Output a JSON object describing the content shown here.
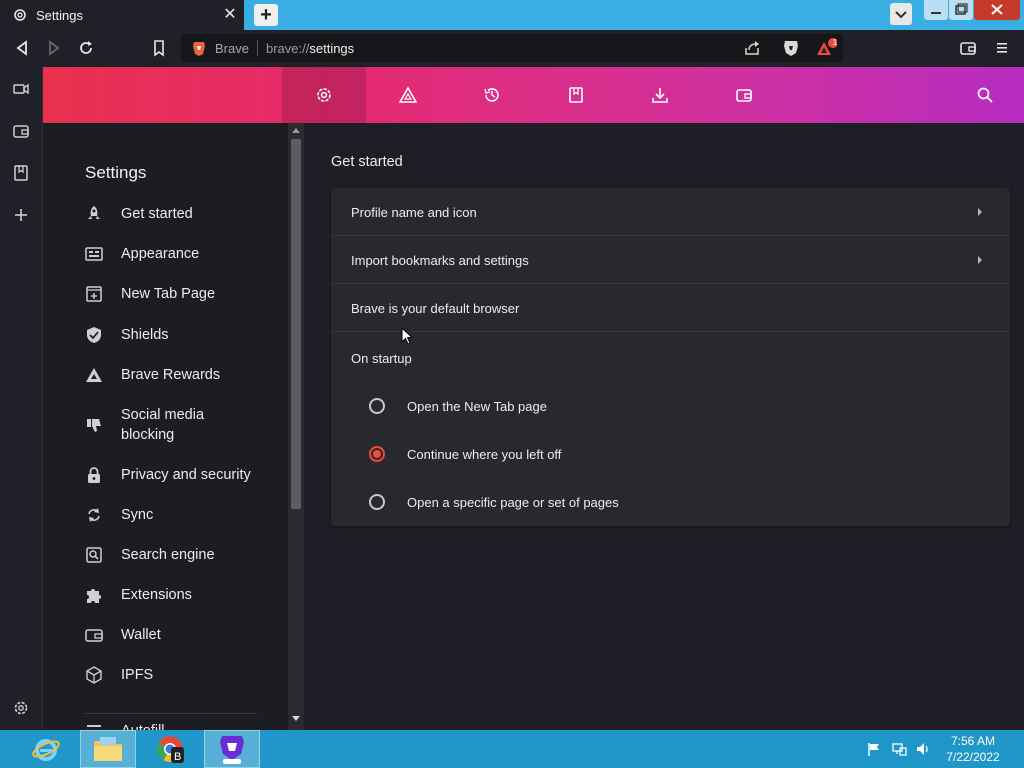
{
  "window": {
    "tab_title": "Settings",
    "tab_close": "✕",
    "new_tab": "+"
  },
  "toolbar": {
    "omnibox_brand": "Brave",
    "url_scheme": "brave://",
    "url_path": "settings",
    "rewards_badge": "1"
  },
  "sidebar_icons": [
    "video-call-icon",
    "wallet-icon",
    "bookmarks-icon",
    "add-icon",
    "settings-icon"
  ],
  "header": {
    "items": [
      "settings-gear-icon",
      "rewards-triangle-icon",
      "history-icon",
      "bookmarks-icon",
      "downloads-icon",
      "wallet-icon"
    ],
    "search_icon": "search-icon"
  },
  "nav": {
    "title": "Settings",
    "items": [
      {
        "label": "Get started",
        "icon": "rocket-icon"
      },
      {
        "label": "Appearance",
        "icon": "appearance-icon"
      },
      {
        "label": "New Tab Page",
        "icon": "new-tab-page-icon"
      },
      {
        "label": "Shields",
        "icon": "shield-icon"
      },
      {
        "label": "Brave Rewards",
        "icon": "rewards-triangle-icon"
      },
      {
        "label": "Social media blocking",
        "icon": "thumbs-down-icon"
      },
      {
        "label": "Privacy and security",
        "icon": "lock-icon"
      },
      {
        "label": "Sync",
        "icon": "sync-icon"
      },
      {
        "label": "Search engine",
        "icon": "search-engine-icon"
      },
      {
        "label": "Extensions",
        "icon": "puzzle-icon"
      },
      {
        "label": "Wallet",
        "icon": "wallet-icon"
      },
      {
        "label": "IPFS",
        "icon": "cube-icon"
      },
      {
        "label": "Autofill",
        "icon": "autofill-icon"
      }
    ]
  },
  "main": {
    "section_title": "Get started",
    "rows": [
      {
        "label": "Profile name and icon",
        "has_arrow": true
      },
      {
        "label": "Import bookmarks and settings",
        "has_arrow": true
      },
      {
        "label": "Brave is your default browser",
        "has_arrow": false
      }
    ],
    "startup_label": "On startup",
    "startup_options": [
      {
        "label": "Open the New Tab page",
        "selected": false
      },
      {
        "label": "Continue where you left off",
        "selected": true
      },
      {
        "label": "Open a specific page or set of pages",
        "selected": false
      }
    ]
  },
  "taskbar": {
    "apps": [
      "internet-explorer-icon",
      "file-explorer-icon",
      "chrome-beta-icon",
      "brave-nightly-icon"
    ],
    "time": "7:56 AM",
    "date": "7/22/2022"
  },
  "colors": {
    "accent_red": "#f04a3a",
    "header_start": "#e9304e",
    "header_end": "#b72cc0",
    "taskbar": "#1f97c9"
  }
}
